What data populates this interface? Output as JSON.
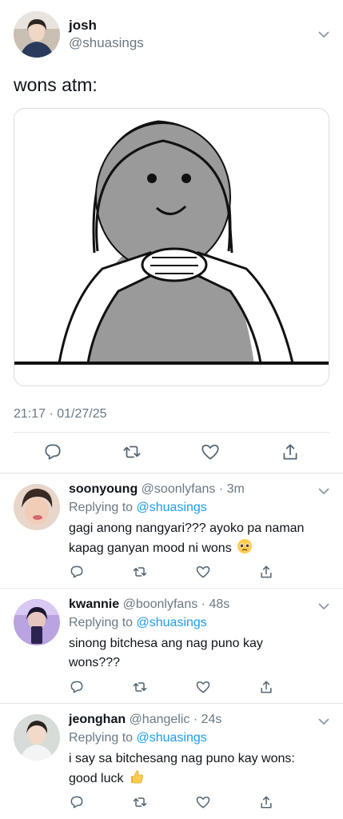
{
  "main_tweet": {
    "display_name": "josh",
    "handle": "@shuasings",
    "text": "wons atm:",
    "timestamp": "21:17 · 01/27/25",
    "media_description": "cartoon-character-hands-clasped"
  },
  "replies": [
    {
      "display_name": "soonyoung",
      "handle": "@soonlyfans",
      "time": "3m",
      "replying_prefix": "Replying to",
      "replying_to": "@shuasings",
      "text": "gagi anong nangyari??? ayoko pa naman kapag ganyan mood ni wons",
      "emoji": "pleading-face-emoji"
    },
    {
      "display_name": "kwannie",
      "handle": "@boonlyfans",
      "time": "48s",
      "replying_prefix": "Replying to",
      "replying_to": "@shuasings",
      "text": "sinong bitchesa ang nag puno kay wons???"
    },
    {
      "display_name": "jeonghan",
      "handle": "@hangelic",
      "time": "24s",
      "replying_prefix": "Replying to",
      "replying_to": "@shuasings",
      "text": "i say sa bitchesang nag puno kay wons: good luck",
      "emoji": "thumbs-up-emoji"
    }
  ],
  "icons": {
    "reply": "reply-icon",
    "retweet": "retweet-icon",
    "like": "heart-icon",
    "share": "share-icon",
    "more": "chevron-down-icon"
  },
  "colors": {
    "text": "#0f1419",
    "secondary": "#6b7883",
    "link": "#1d9bf0",
    "divider": "#e1e6ea"
  }
}
